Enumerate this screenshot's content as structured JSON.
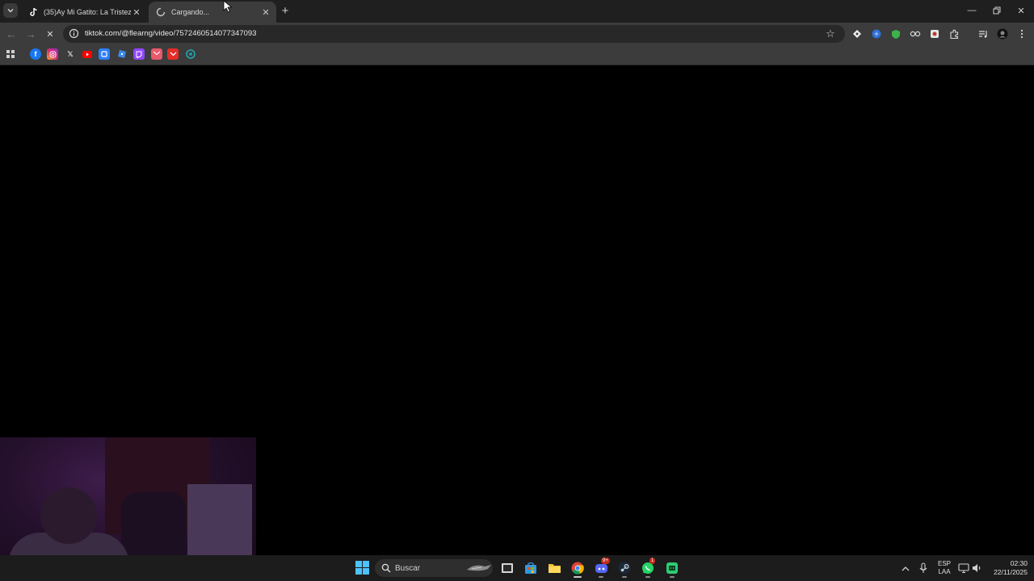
{
  "browser": {
    "tabs": [
      {
        "title": "(35)Ay Mi Gatito: La Tristeza de",
        "favicon": "tiktok-icon",
        "active": false
      },
      {
        "title": "Cargando...",
        "favicon": "loading-spinner-icon",
        "active": true
      }
    ],
    "address_bar": {
      "url": "tiktok.com/@flearng/video/7572460514077347093"
    },
    "bookmarks": [
      "facebook-icon",
      "instagram-icon",
      "x-icon",
      "youtube-icon",
      "bookmark-5-icon",
      "roblox-icon",
      "twitch-icon",
      "gmail-icon",
      "bookmark-9-icon",
      "bookmark-10-icon"
    ]
  },
  "taskbar": {
    "search_placeholder": "Buscar",
    "language": {
      "line1": "ESP",
      "line2": "LAA"
    },
    "clock": {
      "time": "02:30",
      "date": "22/11/2025"
    },
    "badges": {
      "discord": "9+",
      "whatsapp": "1"
    }
  },
  "colors": {
    "chrome_dark": "#1f1f1f",
    "toolbar": "#3c3c3c",
    "taskbar": "#1c1c1c"
  }
}
